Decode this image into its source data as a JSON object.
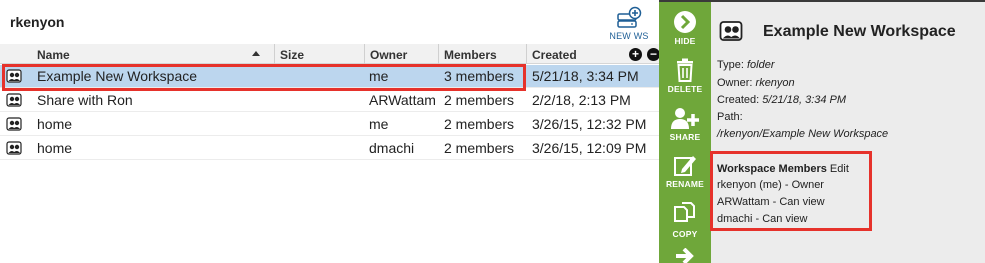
{
  "header": {
    "user": "rkenyon",
    "new_ws_label": "NEW WS"
  },
  "columns": {
    "name": "Name",
    "size": "Size",
    "owner": "Owner",
    "members": "Members",
    "created": "Created"
  },
  "rows": [
    {
      "name": "Example New Workspace",
      "size": "",
      "owner": "me",
      "members": "3 members",
      "created": "5/21/18, 3:34 PM",
      "selected": true
    },
    {
      "name": "Share with Ron",
      "size": "",
      "owner": "ARWattam",
      "members": "2 members",
      "created": "2/2/18, 2:13 PM",
      "selected": false
    },
    {
      "name": "home",
      "size": "",
      "owner": "me",
      "members": "2 members",
      "created": "3/26/15, 12:32 PM",
      "selected": false
    },
    {
      "name": "home",
      "size": "",
      "owner": "dmachi",
      "members": "2 members",
      "created": "3/26/15, 12:09 PM",
      "selected": false
    }
  ],
  "actions": {
    "hide": "HIDE",
    "delete": "DELETE",
    "share": "SHARE",
    "rename": "RENAME",
    "copy": "COPY"
  },
  "details": {
    "title": "Example New Workspace",
    "type_label": "Type:",
    "type_value": "folder",
    "owner_label": "Owner:",
    "owner_value": "rkenyon",
    "created_label": "Created:",
    "created_value": "5/21/18, 3:34 PM",
    "path_label": "Path:",
    "path_value": "/rkenyon/Example New Workspace",
    "members_title": "Workspace Members",
    "edit_label": "Edit",
    "members": [
      "rkenyon (me) - Owner",
      "ARWattam - Can view",
      "dmachi - Can view"
    ]
  },
  "colors": {
    "action_bar": "#6fa73a",
    "selection": "#bcd6ee",
    "highlight": "#e6322b",
    "details_bg": "#ececec"
  },
  "icons": {
    "workspace": "shared-workspace-icon",
    "new_ws": "database-plus-icon"
  }
}
